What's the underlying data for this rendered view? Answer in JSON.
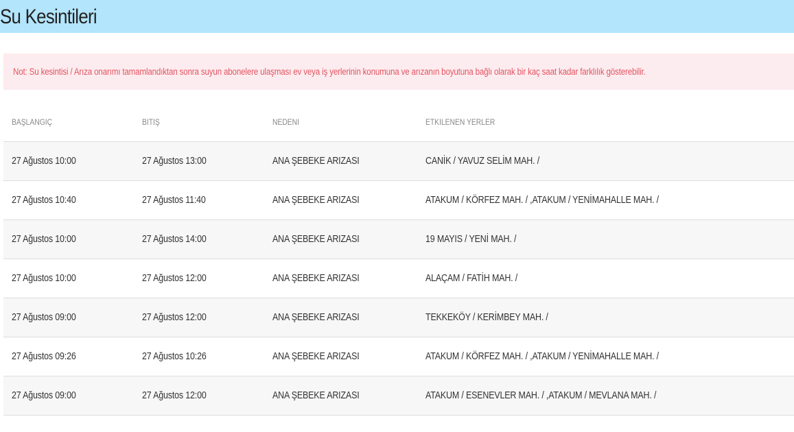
{
  "page": {
    "title": "Su Kesintileri",
    "notice": "Not: Su kesintisi / Arıza onarımı tamamlandıktan sonra suyun abonelere ulaşması ev veya iş yerlerinin konumuna ve arızanın boyutuna bağlı olarak bir kaç saat kadar farklılık gösterebilir."
  },
  "table": {
    "headers": [
      "BAŞLANGIÇ",
      "BITIŞ",
      "NEDENI",
      "ETKILENEN YERLER"
    ],
    "rows": [
      [
        "27 Ağustos 10:00",
        "27 Ağustos 13:00",
        "ANA ŞEBEKE ARIZASI",
        "CANİK / YAVUZ SELİM MAH. /"
      ],
      [
        "27 Ağustos 10:40",
        "27 Ağustos 11:40",
        "ANA ŞEBEKE ARIZASI",
        "ATAKUM / KÖRFEZ MAH. / ,ATAKUM / YENİMAHALLE MAH. /"
      ],
      [
        "27 Ağustos 10:00",
        "27 Ağustos 14:00",
        "ANA ŞEBEKE ARIZASI",
        "19 MAYIS / YENİ MAH. /"
      ],
      [
        "27 Ağustos 10:00",
        "27 Ağustos 12:00",
        "ANA ŞEBEKE ARIZASI",
        "ALAÇAM / FATİH MAH. /"
      ],
      [
        "27 Ağustos 09:00",
        "27 Ağustos 12:00",
        "ANA ŞEBEKE ARIZASI",
        "TEKKEKÖY / KERİMBEY MAH. /"
      ],
      [
        "27 Ağustos 09:26",
        "27 Ağustos 10:26",
        "ANA ŞEBEKE ARIZASI",
        "ATAKUM / KÖRFEZ MAH. / ,ATAKUM / YENİMAHALLE MAH. /"
      ],
      [
        "27 Ağustos 09:00",
        "27 Ağustos 12:00",
        "ANA ŞEBEKE ARIZASI",
        "ATAKUM / ESENEVLER MAH. / ,ATAKUM / MEVLANA MAH. /"
      ]
    ]
  },
  "colors": {
    "title_bar_bg": "#b3e5fc",
    "notice_bg": "#fdecef",
    "notice_text": "#e25563",
    "row_stripe": "#f7f7f7"
  }
}
